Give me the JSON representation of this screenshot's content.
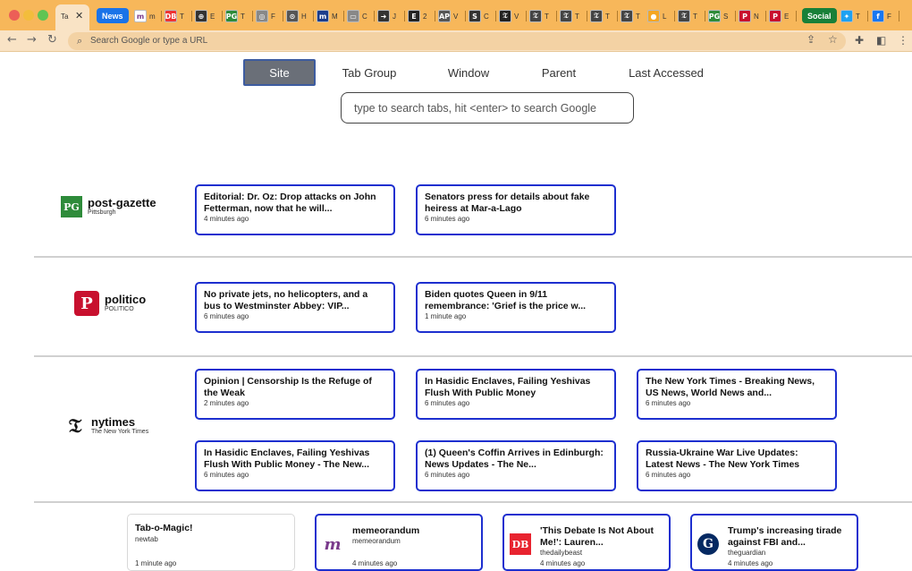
{
  "browser": {
    "active_tab_label": "Ta",
    "group_news": "News",
    "group_social": "Social",
    "tab_letters": [
      "m",
      "T",
      "E",
      "T",
      "F",
      "H",
      "M",
      "C",
      "J",
      "2",
      "V",
      "C",
      "V",
      "T",
      "T",
      "T",
      "T",
      "L",
      "T",
      "S",
      "N",
      "E",
      "T",
      "F"
    ],
    "address_placeholder": "Search Google or type a URL",
    "colors": {
      "tabstrip": "#f7b75a",
      "toolbar": "#f9e3c5",
      "card_border": "#1d2fcf",
      "news_group": "#1a73e8",
      "social_group": "#188038"
    }
  },
  "views": {
    "tabs": [
      {
        "label": "Site",
        "active": true
      },
      {
        "label": "Tab Group",
        "active": false
      },
      {
        "label": "Window",
        "active": false
      },
      {
        "label": "Parent",
        "active": false
      },
      {
        "label": "Last Accessed",
        "active": false
      }
    ],
    "search_placeholder": "type to search tabs, hit <enter> to search Google"
  },
  "groups": [
    {
      "site": "post-gazette",
      "subtitle": "Pittsburgh",
      "icon": "post-gazette-logo-icon",
      "cards": [
        {
          "title": "Editorial: Dr. Oz: Drop attacks on John Fetterman, now that he will...",
          "time": "4 minutes ago"
        },
        {
          "title": "Senators press for details about fake heiress at Mar-a-Lago",
          "time": "6 minutes ago"
        }
      ]
    },
    {
      "site": "politico",
      "subtitle": "POLITICO",
      "icon": "politico-logo-icon",
      "cards": [
        {
          "title": "No private jets, no helicopters, and a bus to Westminster Abbey: VIP...",
          "time": "6 minutes ago"
        },
        {
          "title": "Biden quotes Queen in 9/11 remembrance: 'Grief is the price w...",
          "time": "1 minute ago"
        }
      ]
    },
    {
      "site": "nytimes",
      "subtitle": "The New York Times",
      "icon": "nytimes-logo-icon",
      "cards": [
        {
          "title": "Opinion | Censorship Is the Refuge of the Weak",
          "time": "2 minutes ago"
        },
        {
          "title": "In Hasidic Enclaves, Failing Yeshivas Flush With Public Money",
          "time": "6 minutes ago"
        },
        {
          "title": "The New York Times - Breaking News, US News, World News and...",
          "time": "6 minutes ago"
        },
        {
          "title": "In Hasidic Enclaves, Failing Yeshivas Flush With Public Money - The New...",
          "time": "6 minutes ago"
        },
        {
          "title": "(1) Queen's Coffin Arrives in Edinburgh: News Updates - The Ne...",
          "time": "6 minutes ago"
        },
        {
          "title": "Russia-Ukraine War Live Updates: Latest News - The New York Times",
          "time": "6 minutes ago"
        }
      ]
    }
  ],
  "recent": [
    {
      "title": "Tab-o-Magic!",
      "sub": "newtab",
      "time": "1 minute ago",
      "icon": ""
    },
    {
      "title": "memeorandum",
      "sub": "memeorandum",
      "time": "4 minutes ago",
      "icon": "memeorandum-icon"
    },
    {
      "title": "'This Debate Is Not About Me!': Lauren...",
      "sub": "thedailybeast",
      "time": "4 minutes ago",
      "icon": "daily-beast-icon"
    },
    {
      "title": "Trump's increasing tirade against FBI and...",
      "sub": "theguardian",
      "time": "4 minutes ago",
      "icon": "guardian-icon"
    }
  ]
}
